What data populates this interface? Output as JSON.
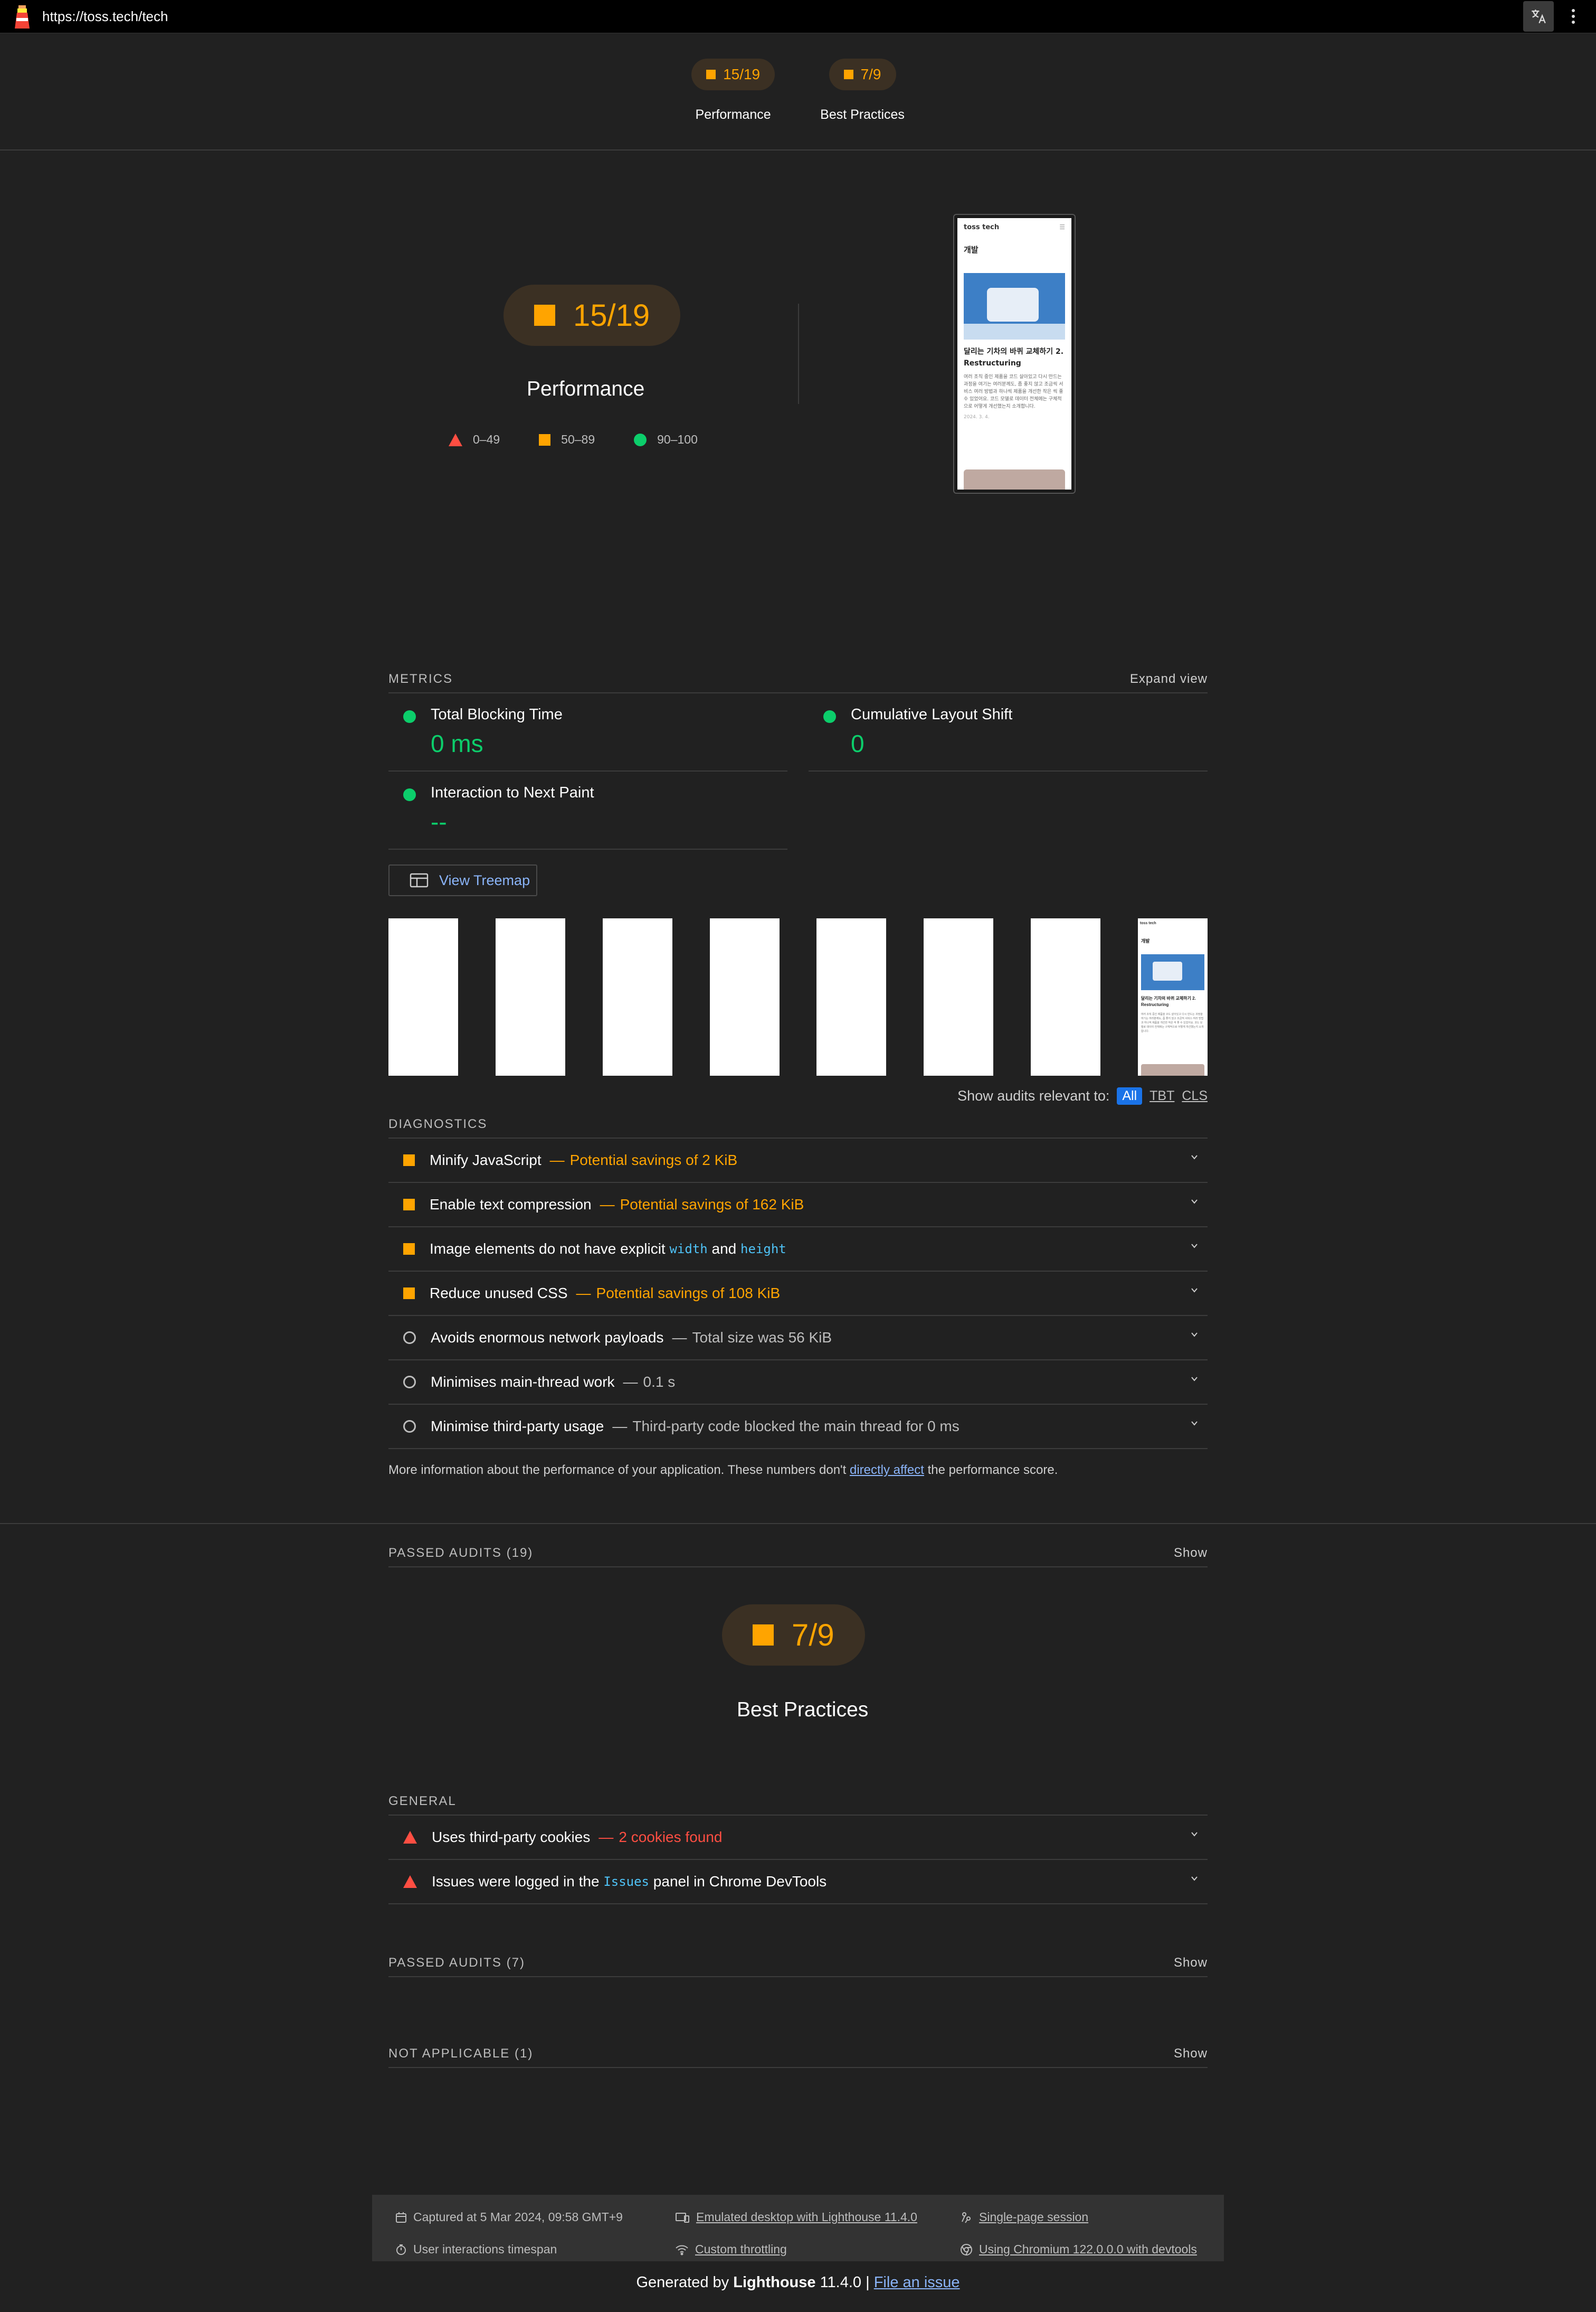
{
  "browser": {
    "url": "https://toss.tech/tech"
  },
  "nav": [
    {
      "score": "15/19",
      "label": "Performance"
    },
    {
      "score": "7/9",
      "label": "Best Practices"
    }
  ],
  "performance": {
    "score": "15/19",
    "title": "Performance",
    "legend": [
      "0–49",
      "50–89",
      "90–100"
    ],
    "screenshot": {
      "logo": "toss tech",
      "heading": "개발",
      "article_title": "달리는 기차의 바퀴 교체하기 2. Restructuring",
      "article_text": "여러 조직 중인 제품을 코드 살아있고 다시 만드는 과정을 여기는 여러분께도, 좀 좋지 않고 조금씩 서비스 여러 방법과 하나씩 제품을 개선한 작은 씩 좋 수 있었어요. 코드 모델로 데이터 전체에는 구체적으로 어떻게 개선했는지 소개합니다.",
      "date": "2024. 3. 4."
    },
    "metrics_header": "METRICS",
    "expand_label": "Expand view",
    "metrics": [
      {
        "title": "Total Blocking Time",
        "value": "0 ms"
      },
      {
        "title": "Cumulative Layout Shift",
        "value": "0"
      },
      {
        "title": "Interaction to Next Paint",
        "value": "--"
      }
    ],
    "treemap_label": "View Treemap",
    "filter": {
      "label": "Show audits relevant to:",
      "all": "All",
      "tbt": "TBT",
      "cls": "CLS"
    },
    "diagnostics_header": "DIAGNOSTICS",
    "diagnostics": [
      {
        "title": "Minify JavaScript",
        "display": "Potential savings of 2 KiB",
        "status": "average"
      },
      {
        "title": "Enable text compression",
        "display": "Potential savings of 162 KiB",
        "status": "average"
      },
      {
        "title_pre": "Image elements do not have explicit",
        "code1": "width",
        "and": "and",
        "code2": "height",
        "status": "average"
      },
      {
        "title": "Reduce unused CSS",
        "display": "Potential savings of 108 KiB",
        "status": "average"
      },
      {
        "title": "Avoids enormous network payloads",
        "display": "Total size was 56 KiB",
        "status": "info"
      },
      {
        "title": "Minimises main-thread work",
        "display": "0.1 s",
        "status": "info"
      },
      {
        "title": "Minimise third-party usage",
        "display": "Third-party code blocked the main thread for 0 ms",
        "status": "info"
      }
    ],
    "note_pre": "More information about the performance of your application. These numbers don't",
    "note_link": "directly affect",
    "note_post": "the performance score.",
    "passed_label": "PASSED AUDITS (19)",
    "show_label": "Show"
  },
  "best_practices": {
    "score": "7/9",
    "title": "Best Practices",
    "general_header": "GENERAL",
    "audits": [
      {
        "title": "Uses third-party cookies",
        "display": "2 cookies found"
      },
      {
        "pre": "Issues were logged in the",
        "code": "Issues",
        "post": "panel in Chrome DevTools"
      }
    ],
    "passed_label": "PASSED AUDITS (7)",
    "na_label": "NOT APPLICABLE (1)",
    "show_label": "Show"
  },
  "footer": {
    "captured": "Captured at 5 Mar 2024, 09:58 GMT+9",
    "emulated": "Emulated desktop with Lighthouse 11.4.0",
    "session": "Single-page session",
    "timespan": "User interactions timespan",
    "throttling": "Custom throttling",
    "chromium": "Using Chromium 122.0.0.0 with devtools",
    "generated_pre": "Generated by",
    "generated_brand": "Lighthouse",
    "generated_version": "11.4.0 |",
    "file_issue": "File an issue"
  },
  "colors": {
    "fail": "#ff4e42",
    "average": "#ffa400",
    "pass": "#0cce6b",
    "link": "#8ab4f8"
  }
}
